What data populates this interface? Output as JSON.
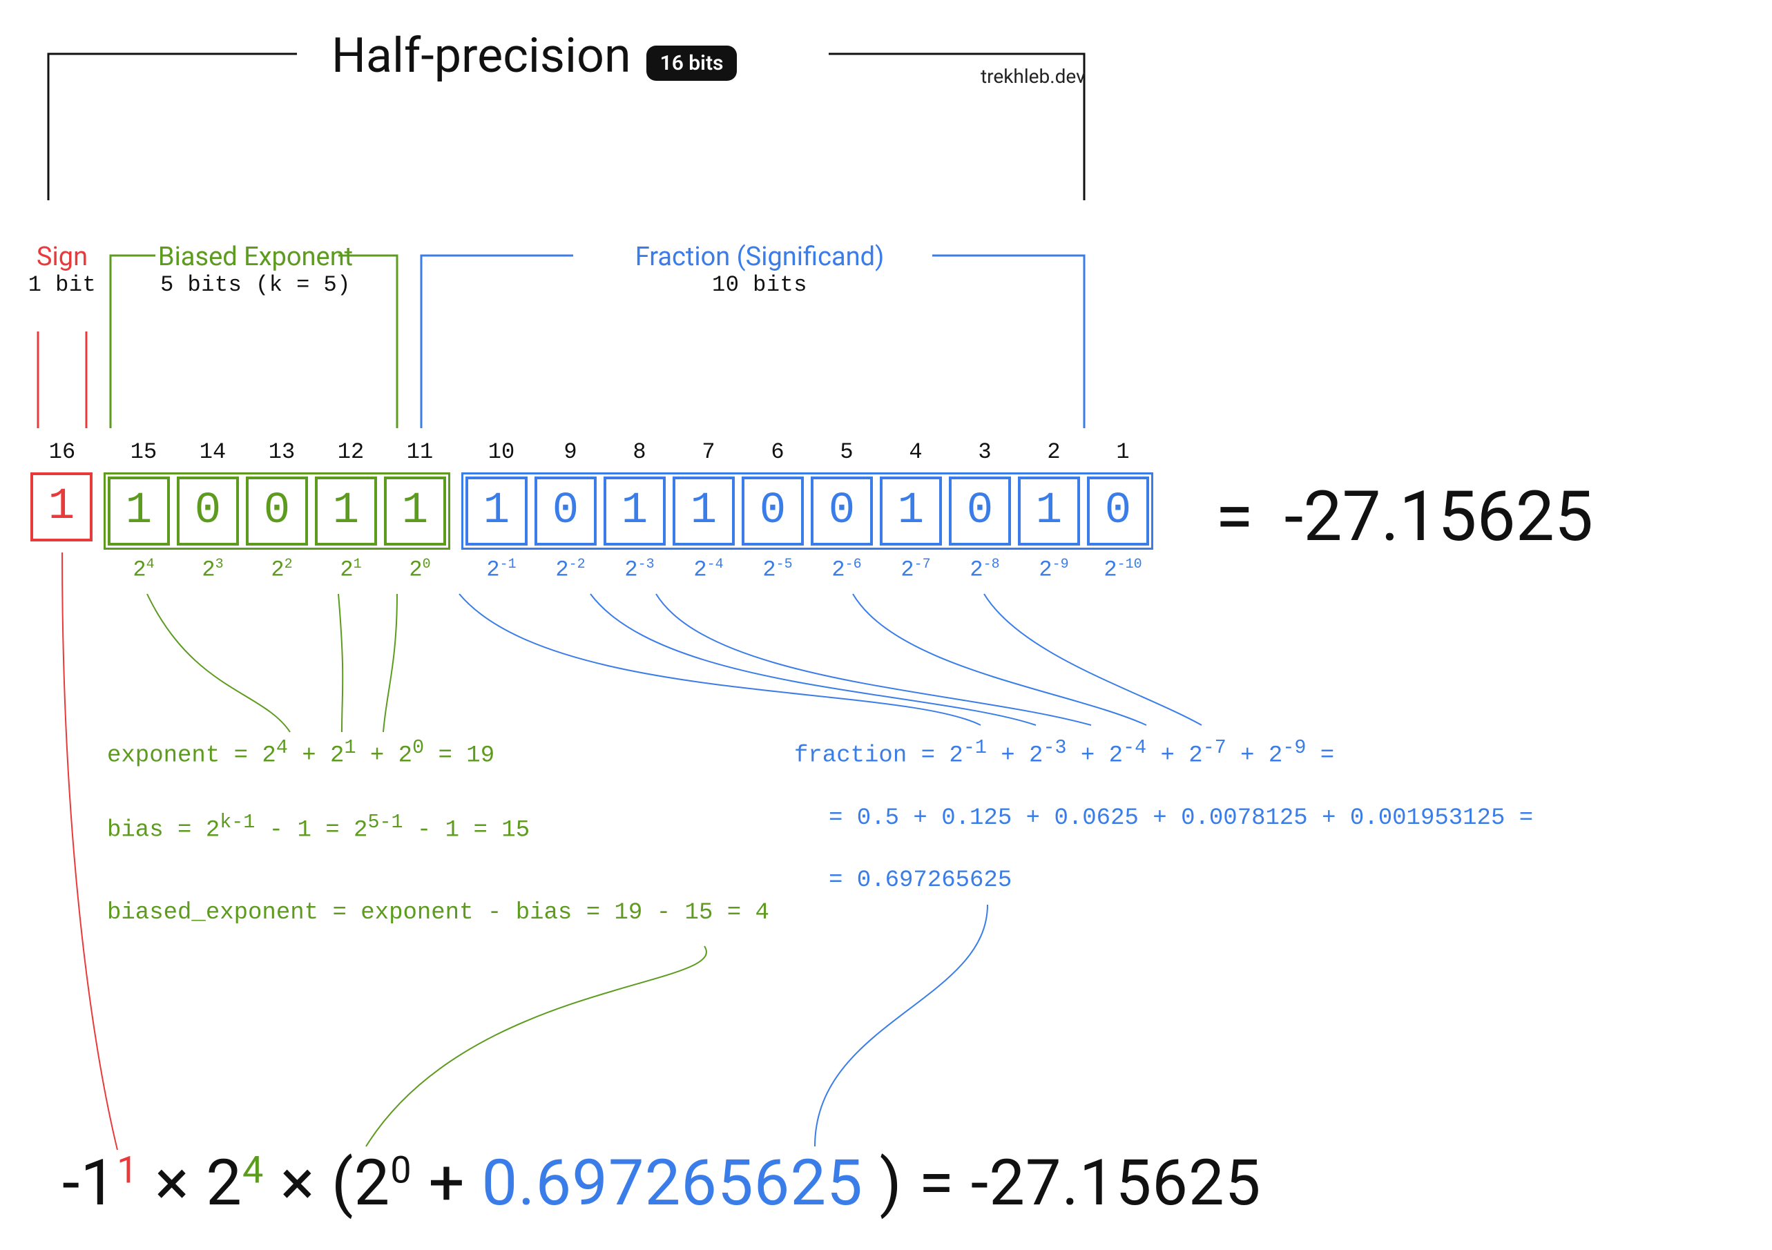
{
  "title": "Half-precision",
  "bits_badge": "16 bits",
  "attribution": "trekhleb.dev",
  "sign": {
    "label": "Sign",
    "sub": "1 bit",
    "bit": "1",
    "index": "16"
  },
  "exponent": {
    "label": "Biased Exponent",
    "sub": "5 bits (k = 5)",
    "bits": [
      "1",
      "0",
      "0",
      "1",
      "1"
    ],
    "indices": [
      "15",
      "14",
      "13",
      "12",
      "11"
    ],
    "weights_base": [
      "2",
      "2",
      "2",
      "2",
      "2"
    ],
    "weights_exp": [
      "4",
      "3",
      "2",
      "1",
      "0"
    ]
  },
  "fraction": {
    "label": "Fraction (Significand)",
    "sub": "10 bits",
    "bits": [
      "1",
      "0",
      "1",
      "1",
      "0",
      "0",
      "1",
      "0",
      "1",
      "0"
    ],
    "indices": [
      "10",
      "9",
      "8",
      "7",
      "6",
      "5",
      "4",
      "3",
      "2",
      "1"
    ],
    "weights_base": [
      "2",
      "2",
      "2",
      "2",
      "2",
      "2",
      "2",
      "2",
      "2",
      "2"
    ],
    "weights_exp": [
      "-1",
      "-2",
      "-3",
      "-4",
      "-5",
      "-6",
      "-7",
      "-8",
      "-9",
      "-10"
    ]
  },
  "eq_equals": "=",
  "decimal_value": "-27.15625",
  "exp_calc": {
    "line1_pre": "exponent = 2",
    "line1_e1": "4",
    "line1_mid1": "+ 2",
    "line1_e2": "1",
    "line1_mid2": "+ 2",
    "line1_e3": "0",
    "line1_post": " = 19",
    "line2_pre": "bias = 2",
    "line2_e1": "k-1",
    "line2_mid1": " - 1 = 2",
    "line2_e2": "5-1",
    "line2_post": " - 1 = 15",
    "line3": "biased_exponent = exponent - bias = 19 - 15 = 4"
  },
  "frac_calc": {
    "line1_pre": "fraction = 2",
    "line1_e1": "-1",
    "line1_m1": " + 2",
    "line1_e2": "-3",
    "line1_m2": " + 2",
    "line1_e3": "-4",
    "line1_m3": " + 2",
    "line1_e4": "-7",
    "line1_m4": " + 2",
    "line1_e5": "-9",
    "line1_post": " =",
    "line2": "= 0.5 + 0.125 + 0.0625 + 0.0078125 + 0.001953125 =",
    "line3": "= 0.697265625"
  },
  "final": {
    "p1": "-1",
    "sup1": "1",
    "p2": "  ×  2",
    "sup2": "4",
    "p3": "  ×  (2",
    "sup3": "0",
    "p4": " + ",
    "frac_value": "0.697265625",
    "p5": ") = ",
    "result": "-27.15625"
  }
}
